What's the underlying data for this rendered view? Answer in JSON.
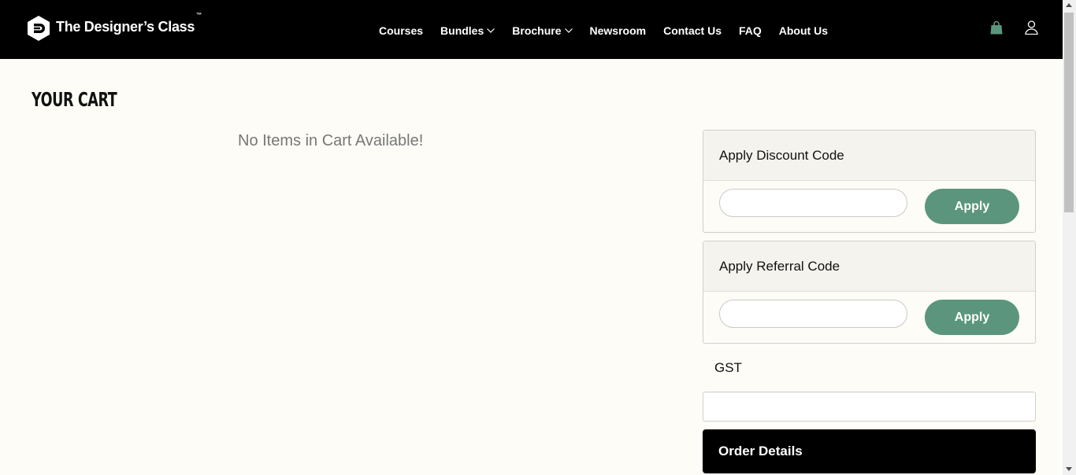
{
  "brand": {
    "name": "The Designer’s Class",
    "tm": "™"
  },
  "nav": {
    "items": [
      {
        "label": "Courses",
        "dropdown": false
      },
      {
        "label": "Bundles",
        "dropdown": true
      },
      {
        "label": "Brochure",
        "dropdown": true
      },
      {
        "label": "Newsroom",
        "dropdown": false
      },
      {
        "label": "Contact Us",
        "dropdown": false
      },
      {
        "label": "FAQ",
        "dropdown": false
      },
      {
        "label": "About Us",
        "dropdown": false
      }
    ],
    "icons": {
      "cart": "shopping-bag-icon",
      "account": "user-icon"
    },
    "cart_color": "#5b957d"
  },
  "page": {
    "title": "YOUR CART",
    "empty_message": "No Items in Cart Available!"
  },
  "discount": {
    "heading": "Apply Discount Code",
    "value": "",
    "button": "Apply"
  },
  "referral": {
    "heading": "Apply Referral Code",
    "value": "",
    "button": "Apply"
  },
  "gst": {
    "label": "GST",
    "value": ""
  },
  "order": {
    "heading": "Order Details"
  },
  "colors": {
    "accent": "#5b957d",
    "nav_bg": "#000000",
    "page_bg": "#fdfcf7"
  }
}
